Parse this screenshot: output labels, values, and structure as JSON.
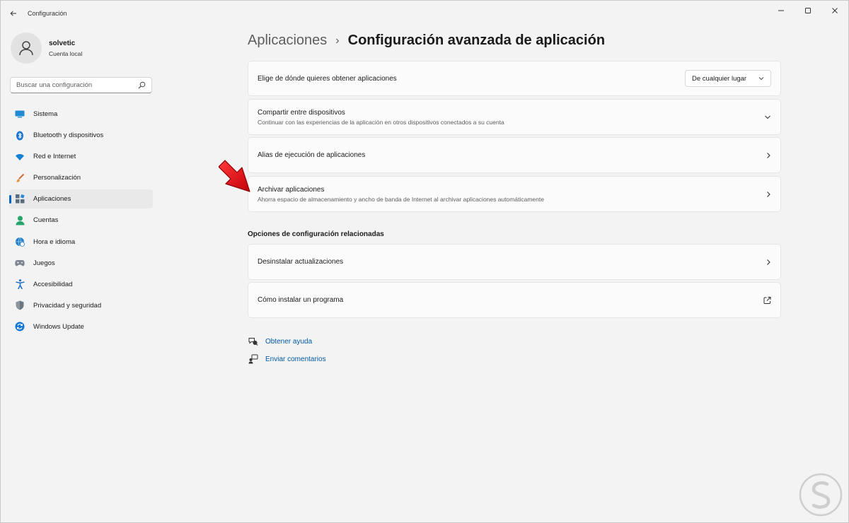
{
  "window": {
    "title": "Configuración"
  },
  "profile": {
    "name": "solvetic",
    "account_type": "Cuenta local"
  },
  "search": {
    "placeholder": "Buscar una configuración"
  },
  "sidebar": {
    "items": [
      {
        "label": "Sistema",
        "icon": "system-icon"
      },
      {
        "label": "Bluetooth y dispositivos",
        "icon": "bluetooth-icon"
      },
      {
        "label": "Red e Internet",
        "icon": "wifi-icon"
      },
      {
        "label": "Personalización",
        "icon": "brush-icon"
      },
      {
        "label": "Aplicaciones",
        "icon": "apps-icon",
        "active": true
      },
      {
        "label": "Cuentas",
        "icon": "accounts-icon"
      },
      {
        "label": "Hora e idioma",
        "icon": "globe-clock-icon"
      },
      {
        "label": "Juegos",
        "icon": "gamepad-icon"
      },
      {
        "label": "Accesibilidad",
        "icon": "accessibility-icon"
      },
      {
        "label": "Privacidad y seguridad",
        "icon": "shield-icon"
      },
      {
        "label": "Windows Update",
        "icon": "update-icon"
      }
    ]
  },
  "breadcrumb": {
    "parent": "Aplicaciones",
    "current": "Configuración avanzada de aplicación"
  },
  "settings": {
    "source": {
      "title": "Elige de dónde quieres obtener aplicaciones",
      "selected": "De cualquier lugar"
    },
    "share": {
      "title": "Compartir entre dispositivos",
      "description": "Continuar con las experiencias de la aplicación en otros dispositivos conectados a su cuenta"
    },
    "alias": {
      "title": "Alias de ejecución de aplicaciones"
    },
    "archive": {
      "title": "Archivar aplicaciones",
      "description": "Ahorra espacio de almacenamiento y ancho de banda de Internet al archivar aplicaciones automáticamente"
    }
  },
  "related": {
    "heading": "Opciones de configuración relacionadas",
    "uninstall_updates": "Desinstalar actualizaciones",
    "install_program": "Cómo instalar un programa"
  },
  "help": {
    "get_help": "Obtener ayuda",
    "feedback": "Enviar comentarios"
  },
  "colors": {
    "accent": "#0067c0",
    "link": "#0058a8",
    "annotation_arrow": "#e8101a"
  }
}
